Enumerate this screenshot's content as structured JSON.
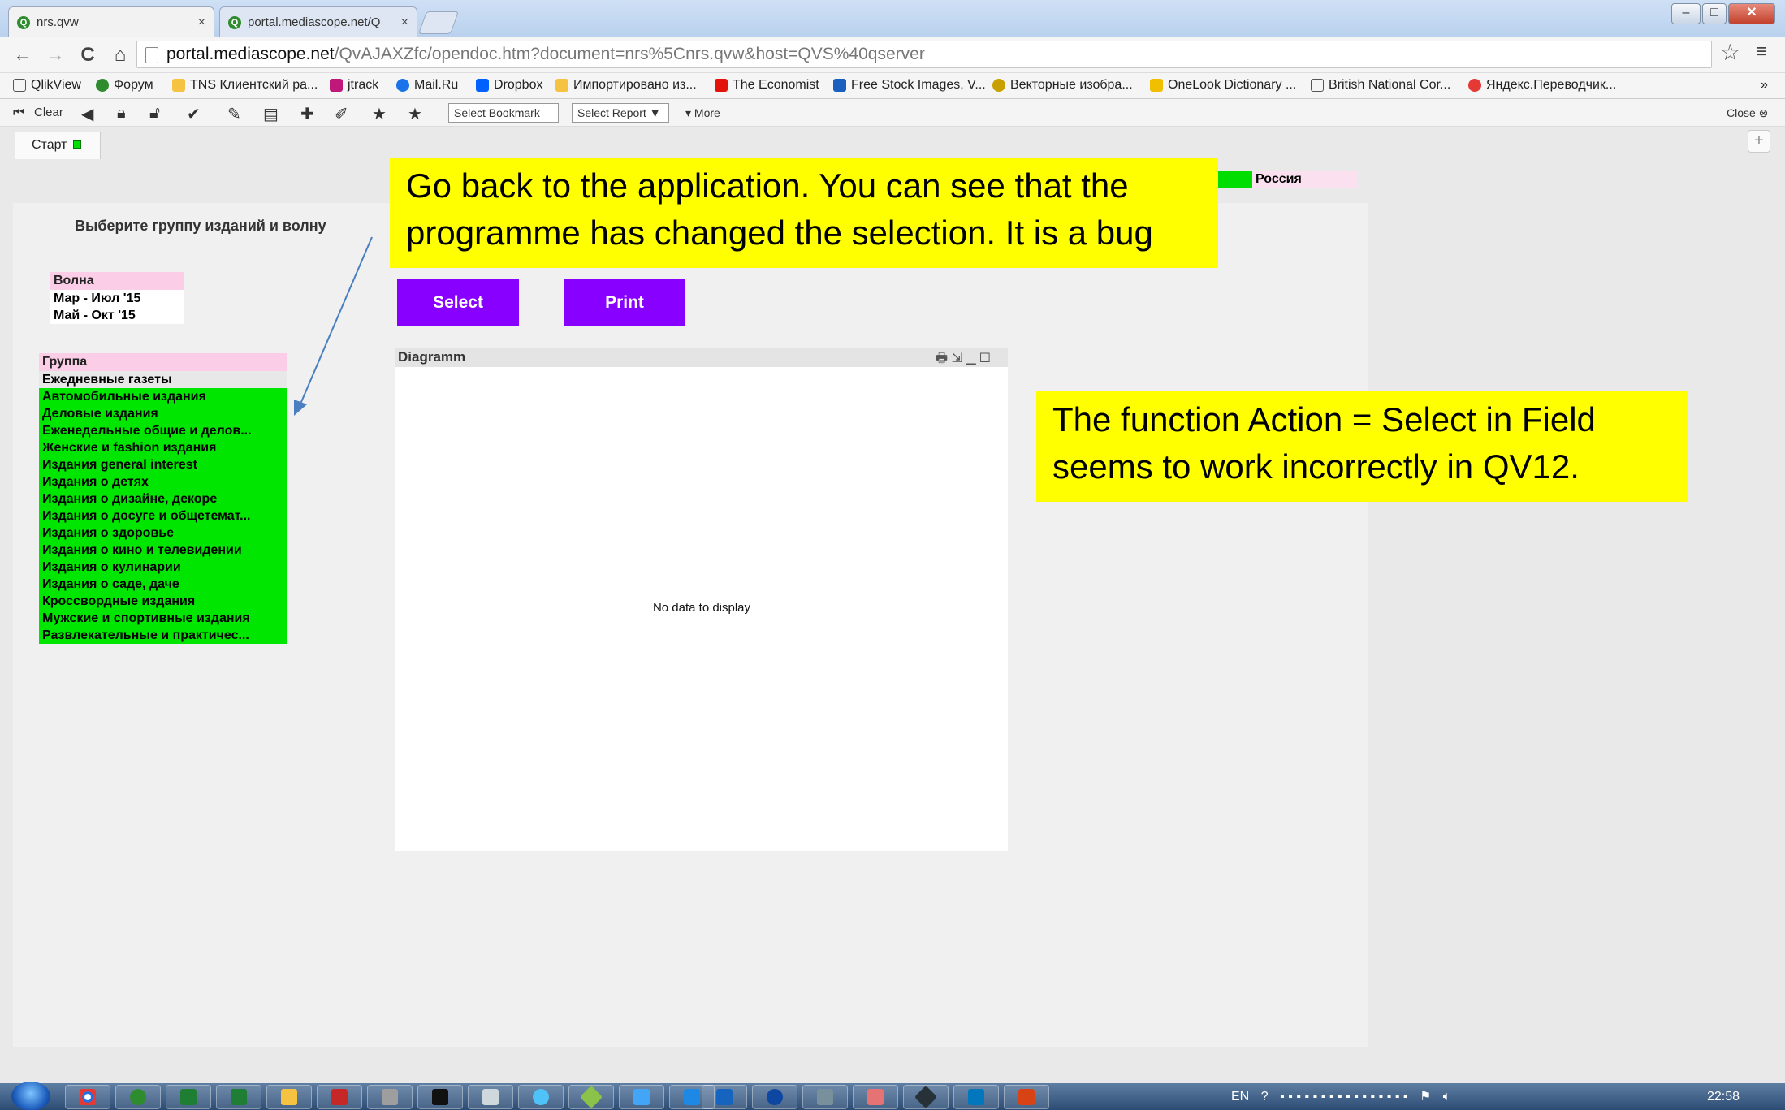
{
  "browser": {
    "tabs": [
      {
        "label": "nrs.qvw",
        "close": "×"
      },
      {
        "label": "portal.mediascope.net/Q",
        "close": "×"
      }
    ],
    "url": {
      "host": "portal.mediascope.net",
      "path": "/QvAJAXZfc/opendoc.htm?document=nrs%5Cnrs.qvw&host=QVS%40qserver"
    },
    "nav": {
      "back": "←",
      "forward": "→",
      "reload": "C",
      "home": "⌂",
      "star": "☆",
      "menu": "≡"
    },
    "window": {
      "minimize": "–",
      "maximize": "□",
      "close": "✕"
    },
    "bookmarks": [
      {
        "label": "QlikView",
        "color": "#ffffff"
      },
      {
        "label": "Форум",
        "color": "#2e8b2e"
      },
      {
        "label": "TNS Клиентский ра...",
        "color": "#f5c242"
      },
      {
        "label": "jtrack",
        "color": "#c0177a"
      },
      {
        "label": "Mail.Ru",
        "color": "#1a73e8"
      },
      {
        "label": "Dropbox",
        "color": "#0061ff"
      },
      {
        "label": "Импортировано из...",
        "color": "#f5c242"
      },
      {
        "label": "The Economist",
        "color": "#e3120b"
      },
      {
        "label": "Free Stock Images, V...",
        "color": "#1a5fbf"
      },
      {
        "label": "Векторные изобра...",
        "color": "#c8a000"
      },
      {
        "label": "OneLook Dictionary ...",
        "color": "#f0c000"
      },
      {
        "label": "British National Cor...",
        "color": "#ffffff"
      },
      {
        "label": "Яндекс.Переводчик...",
        "color": "#e53935"
      }
    ],
    "bookmarks_more": "»"
  },
  "qv_toolbar": {
    "clear": "Clear",
    "select_bookmark": "Select Bookmark",
    "select_report": "Select Report",
    "more": "More",
    "close": "Close"
  },
  "sheet": {
    "tab": "Старт",
    "add_tab": "+",
    "russia": "Россия",
    "prompt": "Выберите группу изданий и волну",
    "wave": {
      "header": "Волна",
      "items": [
        "Мар - Июл '15",
        "Май - Окт '15"
      ]
    },
    "group": {
      "header": "Группа",
      "selected": "Ежедневные газеты",
      "items": [
        "Автомобильные издания",
        "Деловые издания",
        "Еженедельные общие и делов...",
        "Женские и fashion издания",
        "Издания general interest",
        "Издания о детях",
        "Издания о дизайне, декоре",
        "Издания о досуге и общетемат...",
        "Издания о здоровье",
        "Издания о кино и телевидении",
        "Издания о кулинарии",
        "Издания о саде, даче",
        "Кроссвордные издания",
        "Мужские и спортивные издания",
        "Развлекательные и практичес..."
      ]
    },
    "buttons": {
      "select": "Select",
      "print": "Print"
    },
    "chart": {
      "title": "Diagramm",
      "empty": "No data to display"
    }
  },
  "annotations": {
    "note1": "Go back to the application. You can see that the programme has changed the selection. It is a bug",
    "note2": "The function Action = Select in Field seems to work incorrectly in QV12."
  },
  "taskbar": {
    "language": "EN",
    "clock": "22:58"
  }
}
